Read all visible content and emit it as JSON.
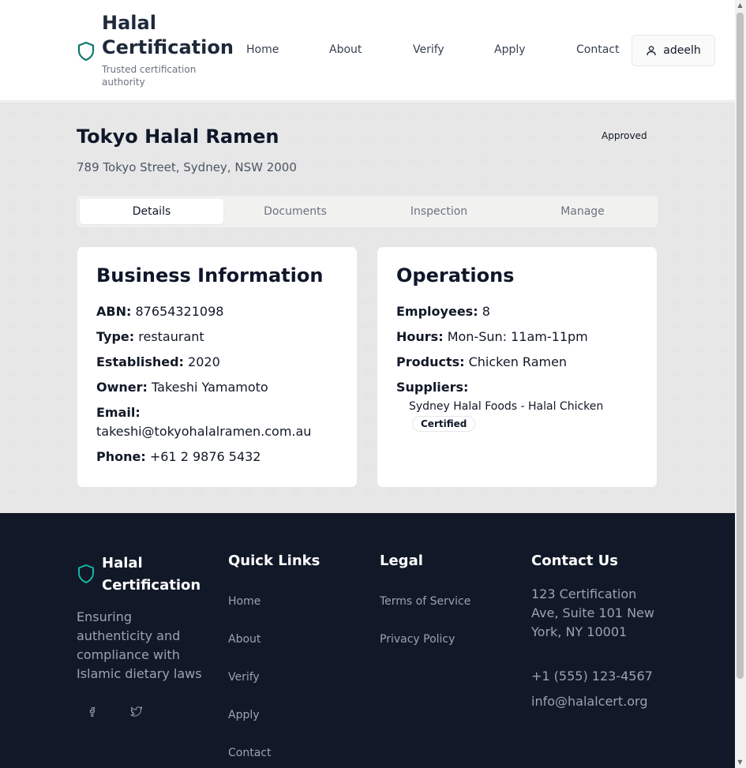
{
  "header": {
    "brand_title": "Halal Certification",
    "brand_tagline": "Trusted certification authority",
    "brand_icon": "shield-icon",
    "nav": [
      "Home",
      "About",
      "Verify",
      "Apply",
      "Contact"
    ],
    "user_name": "adeelh",
    "user_icon": "user-icon"
  },
  "business": {
    "name": "Tokyo Halal Ramen",
    "address": "789 Tokyo Street, Sydney, NSW 2000",
    "status": "Approved"
  },
  "tabs": [
    "Details",
    "Documents",
    "Inspection",
    "Manage"
  ],
  "active_tab": "Details",
  "business_info": {
    "title": "Business Information",
    "abn_label": "ABN:",
    "abn": "87654321098",
    "type_label": "Type:",
    "type": "restaurant",
    "established_label": "Established:",
    "established": "2020",
    "owner_label": "Owner:",
    "owner": "Takeshi Yamamoto",
    "email_label": "Email:",
    "email": "takeshi@tokyohalalramen.com.au",
    "phone_label": "Phone:",
    "phone": "+61 2 9876 5432"
  },
  "operations": {
    "title": "Operations",
    "employees_label": "Employees:",
    "employees": "8",
    "hours_label": "Hours:",
    "hours": "Mon-Sun: 11am-11pm",
    "products_label": "Products:",
    "products": "Chicken Ramen",
    "suppliers_label": "Suppliers:",
    "supplier_name": "Sydney Halal Foods - Halal Chicken",
    "supplier_badge": "Certified"
  },
  "footer": {
    "brand_title": "Halal Certification",
    "description": "Ensuring authenticity and compliance with Islamic dietary laws",
    "social_icons": [
      "facebook-icon",
      "twitter-icon"
    ],
    "quick_links_title": "Quick Links",
    "quick_links": [
      "Home",
      "About",
      "Verify",
      "Apply",
      "Contact"
    ],
    "legal_title": "Legal",
    "legal_links": [
      "Terms of Service",
      "Privacy Policy"
    ],
    "contact_title": "Contact Us",
    "contact_address": "123 Certification Ave, Suite 101 New York, NY 10001",
    "contact_phone": "+1 (555) 123-4567",
    "contact_email": "info@halalcert.org"
  },
  "colors": {
    "accent": "#0f766e",
    "footer_bg": "#111827"
  }
}
